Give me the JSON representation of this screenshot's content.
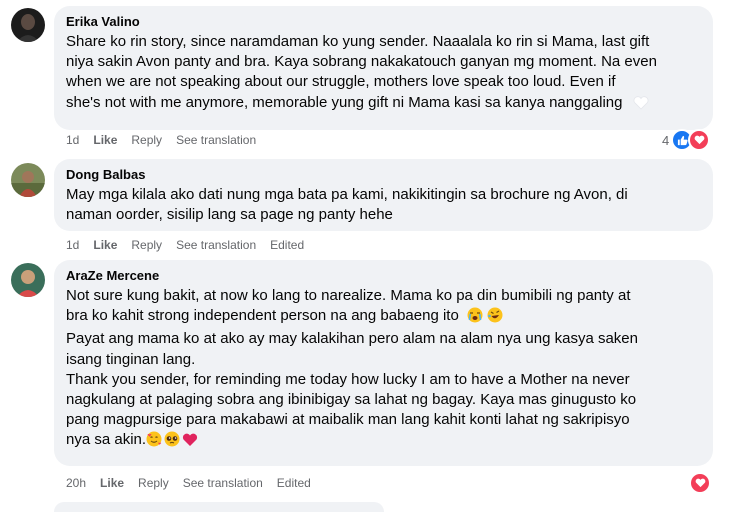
{
  "comments": [
    {
      "author": "Erika Valino",
      "lines": [
        "Share ko rin story, since naramdaman ko yung sender. Naaalala ko rin si Mama, last gift",
        "niya sakin Avon panty and bra. Kaya sobrang nakakatouch ganyan mg moment. Na even",
        "when we are not speaking about our struggle, mothers love speak too loud. Even if",
        "she's not with me anymore, memorable yung gift ni Mama kasi sa kanya nanggaling"
      ],
      "time": "1d",
      "like": "Like",
      "reply": "Reply",
      "translate": "See translation",
      "reaction_count": "4"
    },
    {
      "author": "Dong Balbas",
      "lines": [
        "May mga kilala ako dati nung mga bata pa kami, nakikitingin sa brochure ng Avon, di",
        "naman oorder, sisilip lang sa page ng panty hehe"
      ],
      "time": "1d",
      "like": "Like",
      "reply": "Reply",
      "translate": "See translation",
      "edited": "Edited"
    },
    {
      "author": "AraZe Mercene",
      "lines": [
        "Not sure kung bakit, at now ko lang to narealize. Mama ko pa din bumibili ng panty at",
        "bra ko kahit strong independent person na ang babaeng ito",
        "Payat ang mama ko at ako ay may kalakihan pero alam na alam nya ung kasya saken",
        "isang tinginan lang.",
        "Thank you sender, for reminding me today how lucky I am to have a Mother na never",
        "nagkulang at palaging sobra ang ibinibigay sa lahat ng bagay. Kaya mas ginugusto ko",
        "pang magpursige para makabawi at maibalik man lang kahit konti lahat ng sakripisyo",
        "nya sa akin."
      ],
      "time": "20h",
      "like": "Like",
      "reply": "Reply",
      "translate": "See translation",
      "edited": "Edited"
    }
  ],
  "icons": {
    "like": "like-reaction-icon",
    "love": "love-reaction-icon",
    "white_heart": "white-heart-emoji",
    "crying": "crying-face-emoji",
    "rofl": "rolling-laughing-emoji",
    "hearts_face": "smiling-face-with-hearts-emoji",
    "pleading": "pleading-face-emoji",
    "red_heart": "red-heart-emoji"
  },
  "colors": {
    "bubble": "#f0f2f5",
    "meta": "#65676b",
    "like_blue": "#1877f2",
    "love_red": "#f33e58"
  }
}
